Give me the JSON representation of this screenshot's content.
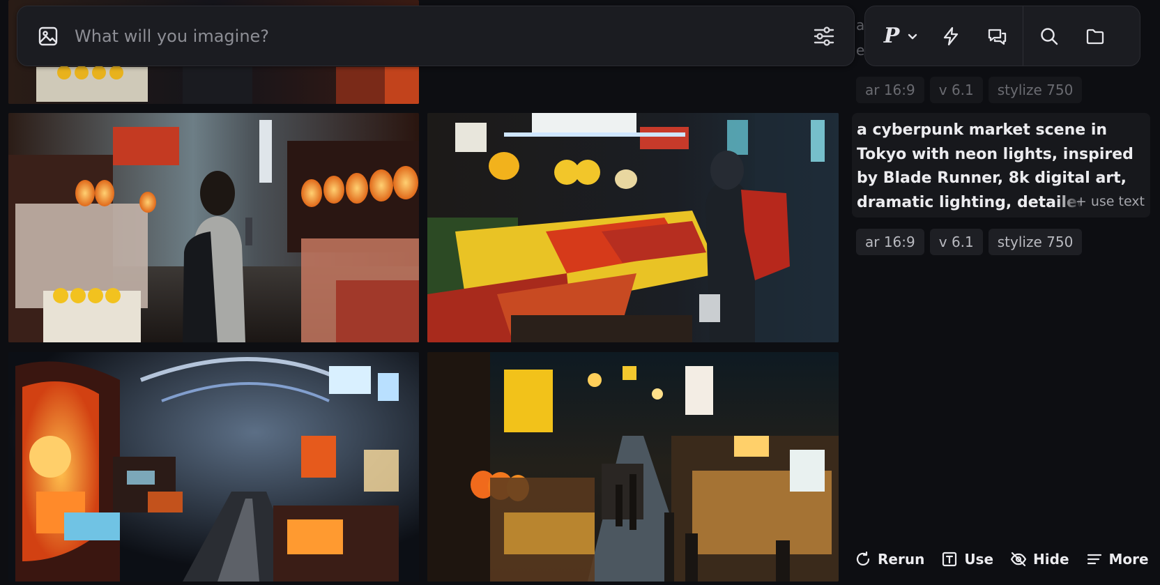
{
  "prompt_bar": {
    "placeholder": "What will you imagine?"
  },
  "toolbar": {
    "profile_letter": "P",
    "icons": [
      "chevron-down-icon",
      "lightning-icon",
      "chat-icon",
      "search-icon",
      "folder-icon"
    ]
  },
  "previous_entry": {
    "text_fragment_1": "a",
    "text_fragment_2": "e",
    "chips": [
      "ar 16:9",
      "v 6.1",
      "stylize 750"
    ]
  },
  "current_entry": {
    "prompt": "a cyberpunk market scene in Tokyo with neon lights, inspired by Blade Runner, 8k digital art, dramatic lighting, detailed environment",
    "use_text": "+ use text",
    "chips": [
      "ar 16:9",
      "v 6.1",
      "stylize 750"
    ]
  },
  "actions": {
    "rerun": "Rerun",
    "use": "Use",
    "hide": "Hide",
    "more": "More"
  },
  "images": [
    "cyberpunk-market-lantern-alley",
    "cyberpunk-fruit-stall-red-backpack",
    "cyberpunk-arcade-corridor",
    "cyberpunk-crowded-night-street"
  ],
  "colors": {
    "background": "#0d0e12",
    "panel": "#1b1c21",
    "chip": "#1e1f24",
    "text": "#ececef",
    "muted": "#8d8e95"
  }
}
